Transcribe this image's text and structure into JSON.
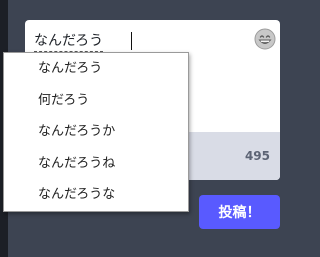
{
  "compose": {
    "text": "なんだろう",
    "char_counter": "495",
    "emoji_icon": "grinning-face-icon"
  },
  "post_button": {
    "label": "投稿！"
  },
  "ime_candidates": [
    "なんだろう",
    "何だろう",
    "なんだろうか",
    "なんだろうね",
    "なんだろうな"
  ],
  "colors": {
    "background": "#3d4452",
    "accent": "#595aff",
    "footer": "#d9dce6",
    "counter": "#5d6475"
  }
}
